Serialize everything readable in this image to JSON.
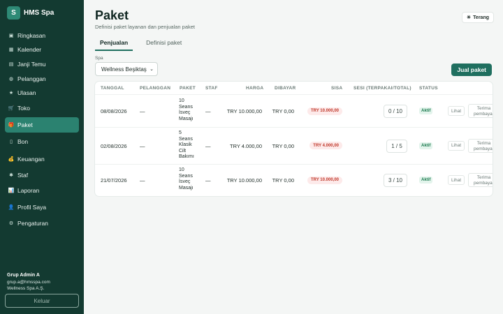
{
  "sidebar": {
    "brand_initial": "S",
    "brand_name": "HMS Spa",
    "items": [
      {
        "label": "Ringkasan",
        "icon": "dashboard-icon",
        "glyph": "▣"
      },
      {
        "label": "Kalender",
        "icon": "calendar-icon",
        "glyph": "▦"
      },
      {
        "label": "Janji Temu",
        "icon": "appointments-icon",
        "glyph": "▤"
      },
      {
        "label": "Pelanggan",
        "icon": "customers-icon",
        "glyph": "◍"
      },
      {
        "label": "Ulasan",
        "icon": "star-icon",
        "glyph": "★"
      },
      {
        "label": "Toko",
        "icon": "cart-icon",
        "glyph": "🛒"
      },
      {
        "label": "Paket",
        "icon": "gift-icon",
        "glyph": "🎁"
      },
      {
        "label": "Bon",
        "icon": "receipt-icon",
        "glyph": "▯"
      },
      {
        "label": "Keuangan",
        "icon": "money-bag-icon",
        "glyph": "💰"
      },
      {
        "label": "Staf",
        "icon": "staff-icon",
        "glyph": "✱"
      },
      {
        "label": "Laporan",
        "icon": "chart-icon",
        "glyph": "📊"
      },
      {
        "label": "Profil Saya",
        "icon": "profile-icon",
        "glyph": "👤"
      },
      {
        "label": "Pengaturan",
        "icon": "settings-icon",
        "glyph": "⚙"
      }
    ],
    "active_label": "Paket",
    "user_name": "Grup Admin A",
    "user_email": "grup.a@hmsspa.com",
    "user_company": "Wellness Spa A.Ş.",
    "logout_label": "Keluar"
  },
  "header": {
    "title": "Paket",
    "subtitle": "Definisi paket layanan dan penjualan paket",
    "theme_label": "Terang",
    "theme_icon": "sun-icon"
  },
  "tabs": [
    {
      "label": "Penjualan",
      "active": true
    },
    {
      "label": "Definisi paket",
      "active": false
    }
  ],
  "filter": {
    "spa_label": "Spa",
    "spa_value": "Wellness Beşiktaş",
    "sell_button": "Jual paket"
  },
  "table": {
    "headers": [
      "TANGGAL",
      "PELANGGAN",
      "PAKET",
      "STAF",
      "HARGA",
      "DIBAYAR",
      "SISA",
      "SESI (TERPAKAI/TOTAL)",
      "STATUS"
    ],
    "rows": [
      {
        "tanggal": "08/08/2026",
        "pelanggan": "—",
        "paket": [
          "10",
          "Seans",
          "İsveç",
          "Masajı"
        ],
        "staf": "—",
        "harga": "TRY 10.000,00",
        "dibayar": "TRY 0,00",
        "sisa": "TRY 10.000,00",
        "sesi": "0 / 10",
        "status": "Aktif",
        "lihat": "Lihat",
        "terima": [
          "Terima",
          "pembayar"
        ]
      },
      {
        "tanggal": "02/08/2026",
        "pelanggan": "—",
        "paket": [
          "5",
          "Seans",
          "Klasik",
          "Cilt",
          "Bakımı"
        ],
        "staf": "—",
        "harga": "TRY 4.000,00",
        "dibayar": "TRY 0,00",
        "sisa": "TRY 4.000,00",
        "sesi": "1 / 5",
        "status": "Aktif",
        "lihat": "Lihat",
        "terima": [
          "Terima",
          "pembayar"
        ]
      },
      {
        "tanggal": "21/07/2026",
        "pelanggan": "—",
        "paket": [
          "10",
          "Seans",
          "İsveç",
          "Masajı"
        ],
        "staf": "—",
        "harga": "TRY 10.000,00",
        "dibayar": "TRY 0,00",
        "sisa": "TRY 10.000,00",
        "sesi": "3 / 10",
        "status": "Aktif",
        "lihat": "Lihat",
        "terima": [
          "Terima",
          "pembayar"
        ]
      }
    ]
  },
  "colors": {
    "sidebar_bg": "#133a31",
    "accent": "#1f6f5f",
    "active_nav": "#2b8270",
    "danger_pill": "#fdeaea",
    "success_badge": "#e3f4ec"
  }
}
